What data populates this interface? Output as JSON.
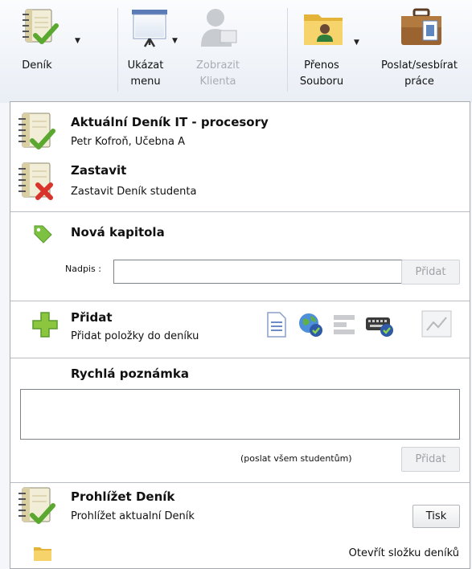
{
  "ribbon": {
    "denik_label": "Deník",
    "ukazat_label_1": "Ukázat",
    "ukazat_label_2": "menu",
    "zobrazit_label_1": "Zobrazit",
    "zobrazit_label_2": "Klienta",
    "prenos_label_1": "Přenos",
    "prenos_label_2": "Souboru",
    "poslat_label_1": "Poslat/sesbírat",
    "poslat_label_2": "práce"
  },
  "current": {
    "title": "Aktuální Deník IT - procesory",
    "subtitle": "Petr Kofroň, Učebna A"
  },
  "stop": {
    "title": "Zastavit",
    "subtitle": "Zastavit Deník studenta"
  },
  "chapter": {
    "title": "Nová kapitola",
    "field_label": "Nadpis :",
    "field_value": "",
    "add_label": "Přidat"
  },
  "add_items": {
    "title": "Přidat",
    "subtitle": "Přidat položky do deníku",
    "icons": [
      "document-icon",
      "globe-check-icon",
      "list-icon",
      "keyboard-check-icon",
      "chart-icon"
    ]
  },
  "quick_note": {
    "title": "Rychlá poznámka",
    "text": "",
    "hint": "(poslat všem studentům)",
    "add_label": "Přidat"
  },
  "browse": {
    "title": "Prohlížet Deník",
    "subtitle": "Prohlížet aktualní Deník",
    "print_label": "Tisk",
    "open_folder": "Otevřít složku deníků"
  },
  "colors": {
    "check_green": "#5aa82f",
    "stop_red": "#d9342b",
    "notebook": "#e9e3c9",
    "folder": "#f5c542",
    "tag": "#7cc142"
  }
}
